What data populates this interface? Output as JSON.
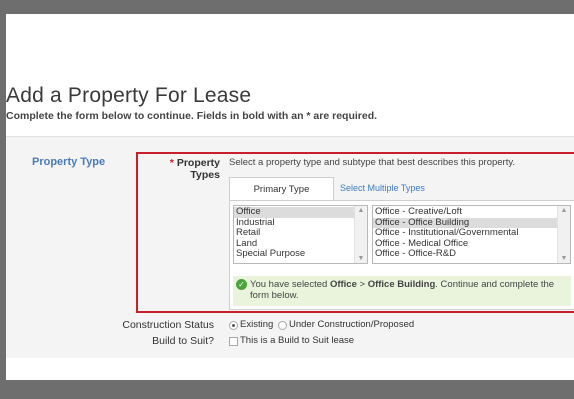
{
  "page": {
    "title": "Add a Property For Lease",
    "subtitle": "Complete the form below to continue. Fields in bold with an * are required."
  },
  "section": {
    "label": "Property Type"
  },
  "property_types": {
    "required_mark": "*",
    "label": "Property Types",
    "instruction": "Select a property type and subtype that best describes this property.",
    "tabs": {
      "primary": "Primary Type",
      "multiple": "Select Multiple Types"
    },
    "primary_list": [
      "Office",
      "Industrial",
      "Retail",
      "Land",
      "Special Purpose"
    ],
    "primary_selected": "Office",
    "subtype_list": [
      "Office - Creative/Loft",
      "Office - Office Building",
      "Office - Institutional/Governmental",
      "Office - Medical Office",
      "Office - Office-R&D"
    ],
    "subtype_selected": "Office - Office Building",
    "notice": {
      "prefix": "You have selected ",
      "type": "Office",
      "separator": " > ",
      "subtype": "Office Building",
      "suffix": ". Continue and complete the form below."
    }
  },
  "construction_status": {
    "label": "Construction Status",
    "options": [
      "Existing",
      "Under Construction/Proposed"
    ],
    "selected": "Existing"
  },
  "build_to_suit": {
    "label": "Build to Suit?",
    "checkbox_label": "This is a Build to Suit lease",
    "checked": false
  },
  "colors": {
    "accent_red": "#c8202a",
    "section_blue": "#4a7bb7",
    "link_blue": "#3c7bc4",
    "success_green": "#49a43a"
  },
  "icons": [
    "check-circle-icon",
    "scroll-up-icon",
    "scroll-down-icon"
  ]
}
